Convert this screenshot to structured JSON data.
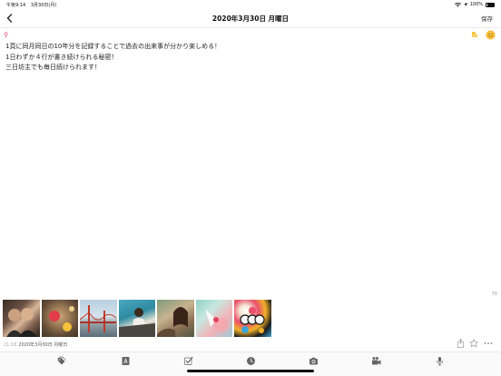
{
  "status_bar": {
    "time": "午後9:14",
    "date": "3月30日(月)",
    "battery": "100%"
  },
  "header": {
    "title": "2020年3月30日 月曜日",
    "save_label": "保存"
  },
  "entry": {
    "lines": [
      "1頁に同月同日の10年分を記録することで過去の出来事が分かり楽しめる！",
      "1日わずか４行が書き続けられる秘密！",
      "三日坊主でも毎日続けられます！"
    ],
    "char_count": "70",
    "time": "21:18",
    "date": "2020年3月30日 月曜日"
  },
  "photos_count": 7,
  "colors": {
    "accent_pink": "#e0607a",
    "weather_yellow": "#f5c022",
    "mood_orange": "#f2a81d",
    "icon_gray": "#666666"
  },
  "toolbar_icons": [
    "tag-icon",
    "text-format-icon",
    "checkbox-icon",
    "clock-icon",
    "camera-icon",
    "video-camera-icon",
    "microphone-icon"
  ]
}
